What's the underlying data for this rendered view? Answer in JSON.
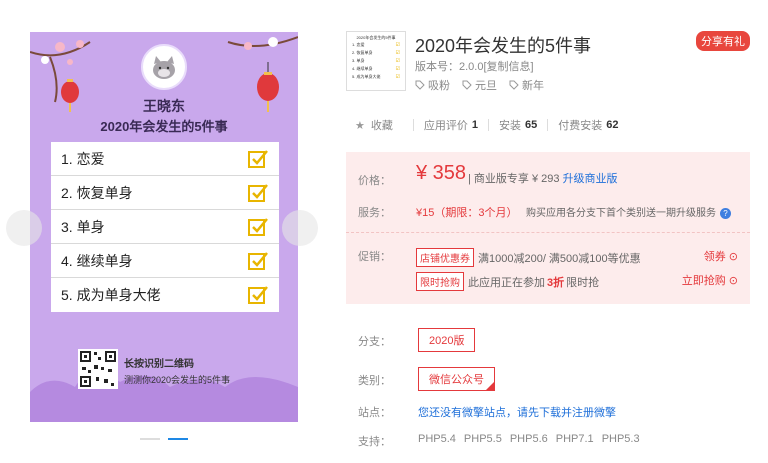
{
  "preview": {
    "name": "王晓东",
    "title": "2020年会发生的5件事",
    "items": [
      "1. 恋爱",
      "2. 恢复单身",
      "3. 单身",
      "4. 继续单身",
      "5. 成为单身大佬"
    ],
    "qr_line1": "长按识别二维码",
    "qr_line2": "测测你2020会发生的5件事",
    "bg_color": "#c9a8ec"
  },
  "thumbnail": {
    "title": "2020年会发生的5件事",
    "items": [
      "1. 恋爱",
      "2. 恢复单身",
      "3. 单身",
      "4. 继续单身",
      "5. 成为单身大佬"
    ]
  },
  "app": {
    "title": "2020年会发生的5件事",
    "share_label": "分享有礼",
    "version": "版本号：2.0.0[复制信息]",
    "tags": [
      "吸粉",
      "元旦",
      "新年"
    ]
  },
  "stats": {
    "favorite": "收藏",
    "rating_label": "应用评价",
    "rating_value": "1",
    "install_label": "安装",
    "install_value": "65",
    "paid_label": "付费安装",
    "paid_value": "62"
  },
  "pricing": {
    "price_label": "价格：",
    "price": "¥ 358",
    "price_extra": "| 商业版专享 ¥ 293",
    "upgrade_link": "升级商业版",
    "service_label": "服务：",
    "service": "¥15（期限：3个月）",
    "service_note": "购买应用各分支下首个类别送一期升级服务",
    "promo_label": "促销：",
    "promo_tag1": "店铺优惠券",
    "promo_text1": "满1000减200/ 满500减100等优惠",
    "promo_link1": "领券",
    "promo_tag2": "限时抢购",
    "promo_text2a": "此应用正在参加",
    "promo_discount": "3折",
    "promo_text2b": "限时抢",
    "promo_link2": "立即抢购"
  },
  "options": {
    "branch_label": "分支：",
    "branch_value": "2020版",
    "category_label": "类别：",
    "category_value": "微信公众号",
    "site_label": "站点：",
    "site_text": "您还没有微擎站点，请先下载并注册微擎",
    "support_label": "支持：",
    "support_versions": [
      "PHP5.4",
      "PHP5.5",
      "PHP5.6",
      "PHP7.1",
      "PHP5.3"
    ]
  },
  "colors": {
    "accent_red": "#e4393c",
    "link_blue": "#1e6fd9",
    "price_bg": "#fdecec"
  }
}
